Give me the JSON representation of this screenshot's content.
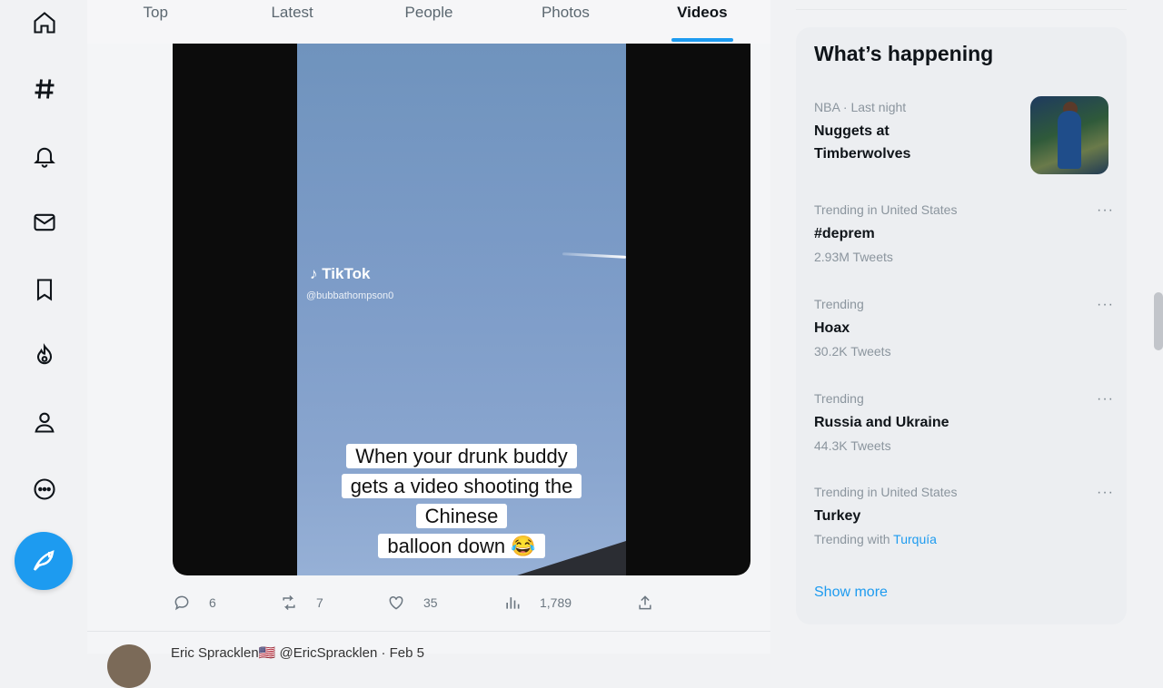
{
  "nav": {
    "items": [
      {
        "icon": "home-icon"
      },
      {
        "icon": "explore-hashtag-icon"
      },
      {
        "icon": "notifications-bell-icon"
      },
      {
        "icon": "messages-envelope-icon"
      },
      {
        "icon": "bookmarks-icon"
      },
      {
        "icon": "communities-icon"
      },
      {
        "icon": "profile-icon"
      },
      {
        "icon": "more-circle-icon"
      }
    ],
    "compose_icon": "compose-feather-icon"
  },
  "tabs": [
    "Top",
    "Latest",
    "People",
    "Photos",
    "Videos"
  ],
  "active_tab": "Videos",
  "tweet": {
    "video": {
      "watermark_brand": "TikTok",
      "watermark_handle": "@bubbathompson0",
      "caption_lines": [
        "When your drunk buddy",
        "gets a video shooting the",
        "Chinese",
        "balloon down 😂"
      ]
    },
    "actions": {
      "replies": "6",
      "retweets": "7",
      "likes": "35",
      "views": "1,789"
    }
  },
  "next_tweet": {
    "author": "Eric Spracklen🇺🇸 @EricSpracklen · Feb 5"
  },
  "sidebar": {
    "title": "What’s happening",
    "trends": [
      {
        "meta": "NBA · Last night",
        "title": "Nuggets at Timberwolves",
        "sub": "",
        "has_image": true
      },
      {
        "meta": "Trending in United States",
        "title": "#deprem",
        "sub": "2.93M Tweets"
      },
      {
        "meta": "Trending",
        "title": "Hoax",
        "sub": "30.2K Tweets"
      },
      {
        "meta": "Trending",
        "title": "Russia and Ukraine",
        "sub": "44.3K Tweets"
      },
      {
        "meta": "Trending in United States",
        "title": "Turkey",
        "sub_prefix": "Trending with",
        "sub_link": "Turquía"
      }
    ],
    "more_label": "···",
    "show_more": "Show more"
  },
  "colors": {
    "accent": "#1d9bf0",
    "text": "#0f1419",
    "muted": "#5b6770"
  }
}
